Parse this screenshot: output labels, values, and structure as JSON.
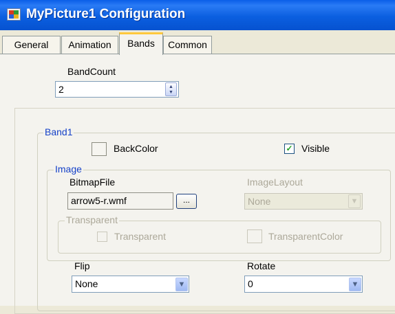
{
  "window": {
    "title": "MyPicture1 Configuration"
  },
  "tabs": [
    "General",
    "Animation",
    "Bands",
    "Common"
  ],
  "band_count": {
    "label": "BandCount",
    "value": "2"
  },
  "band1": {
    "title": "Band1",
    "back_color_label": "BackColor",
    "visible_label": "Visible",
    "visible_checked": true,
    "image": {
      "title": "Image",
      "bitmap_file_label": "BitmapFile",
      "bitmap_file_value": "arrow5-r.wmf",
      "browse_label": "...",
      "image_layout_label": "ImageLayout",
      "image_layout_value": "None",
      "transparent_group_title": "Transparent",
      "transparent_label": "Transparent",
      "transparent_color_label": "TransparentColor"
    },
    "flip": {
      "label": "Flip",
      "value": "None"
    },
    "rotate": {
      "label": "Rotate",
      "value": "0"
    }
  },
  "icons": {
    "window_icon": "app-window-icon",
    "spin": "spin-up-down-icon",
    "dropdown": "chevron-down-icon",
    "check": "checkmark-icon"
  }
}
